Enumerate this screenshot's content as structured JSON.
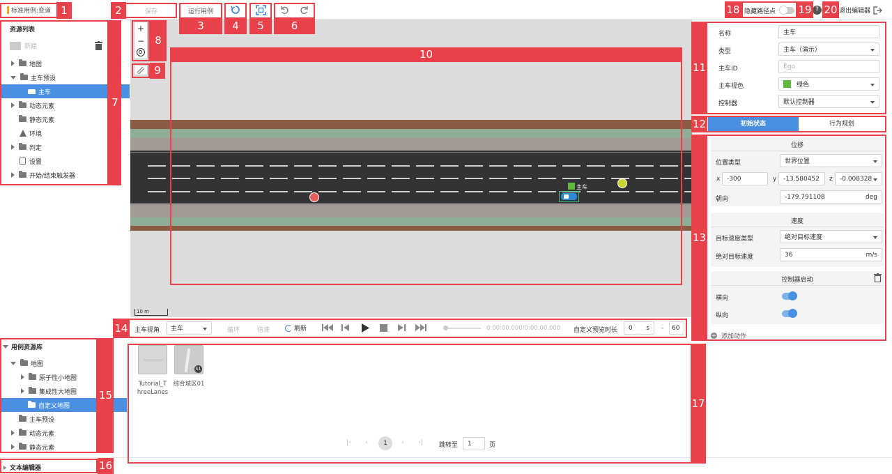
{
  "header": {
    "case_prefix": "标准用例: ",
    "case_name": "变道",
    "save_label": "保存",
    "run_label": "运行用例",
    "hide_route_label": "隐藏路径点",
    "exit_label": "退出编辑器"
  },
  "annotations": [
    "1",
    "2",
    "3",
    "4",
    "5",
    "6",
    "7",
    "8",
    "9",
    "10",
    "11",
    "12",
    "13",
    "14",
    "15",
    "16",
    "17",
    "18",
    "19",
    "20"
  ],
  "resources": {
    "title": "资源列表",
    "new_label": "新建",
    "items": [
      "地图",
      "主车预设",
      "主车",
      "动态元素",
      "静态元素",
      "环境",
      "判定",
      "设置",
      "开始/结束触发器"
    ]
  },
  "zoom": {
    "plus": "+",
    "minus": "−"
  },
  "scene": {
    "ego_label": "主车",
    "scale_label": "10 m"
  },
  "properties": {
    "name_label": "名称",
    "name_value": "主车",
    "type_label": "类型",
    "type_value": "主车（演示）",
    "id_label": "主车ID",
    "id_placeholder": "Ego",
    "color_label": "主车视色",
    "color_value": "绿色",
    "color_hex": "#5fb83d",
    "controller_label": "控制器",
    "controller_value": "默认控制器"
  },
  "tabs": {
    "initial": "初始状态",
    "behavior": "行为规划"
  },
  "position": {
    "title": "位移",
    "pos_type_label": "位置类型",
    "pos_type_value": "世界位置",
    "x_label": "x",
    "x_value": "-300",
    "y_label": "y",
    "y_value": "-13.580452",
    "z_label": "z",
    "z_value": "-0.008328",
    "heading_label": "朝向",
    "heading_value": "-179.791108",
    "heading_unit": "deg"
  },
  "speed": {
    "title": "速度",
    "type_label": "目标速度类型",
    "type_value": "绝对目标速度",
    "abs_label": "绝对目标速度",
    "abs_value": "36",
    "abs_unit": "m/s"
  },
  "controller": {
    "title": "控制器启动",
    "lateral_label": "横向",
    "longitudinal_label": "纵向",
    "add_action_label": "添加动作"
  },
  "playback": {
    "view_label": "主车视角",
    "view_value": "主车",
    "loop_label": "循环",
    "speed_label": "倍速",
    "refresh_label": "刷新",
    "time_label": "0:00:00.000/0:00:00.000",
    "preview_label": "自定义预览时长",
    "start_value": "0",
    "start_unit": "s",
    "dash": "-",
    "end_value": "60"
  },
  "library": {
    "title": "用例资源库",
    "items": [
      "地图",
      "原子性小地图",
      "集成性大地图",
      "自定义地图",
      "主车预设",
      "动态元素",
      "静态元素"
    ]
  },
  "text_editor_label": "文本编辑器",
  "maps": [
    {
      "name": "Tutorial_ThreeLanes"
    },
    {
      "name": "综合城区01",
      "badge": "S1"
    }
  ],
  "pagination": {
    "current": "1",
    "jump_label": "跳转至",
    "jump_value": "1",
    "page_suffix": "页"
  }
}
